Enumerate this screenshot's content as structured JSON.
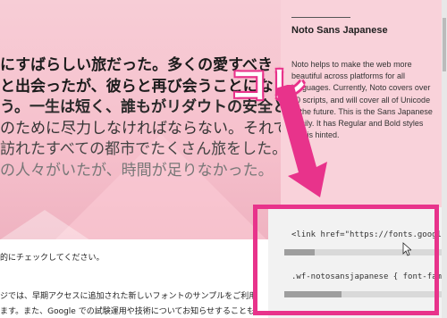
{
  "hero": {
    "lines": [
      "にすばらしい旅だった。多くの愛すべき",
      "と出会ったが、彼らと再び会うことにな",
      "う。一生は短く、誰もがリダウトの安全と",
      "のために尽力しなければならない。それで",
      "訪れたすべての都市でたくさん旅をした。",
      "の人々がいたが、時間が足りなかった。"
    ]
  },
  "side_panel": {
    "title": "Noto Sans Japanese",
    "description": "Noto helps to make the web more beautiful across platforms for all languages. Currently, Noto covers over 30 scripts, and will cover all of Unicode in the future. This is the Sans Japanese family. It has Regular and Bold styles and is hinted."
  },
  "code_panel": {
    "link_line": "<link href=\"https://fonts.googlea",
    "css_line": ".wf-notosansjapanese { font-fami"
  },
  "annotation": {
    "label": "コレ",
    "color": "#e8338b"
  },
  "lower": {
    "line1": "的にチェックしてください。",
    "line2": "ジでは、早期アクセスに追加された新しいフォントのサンプルをご利用",
    "line3": "ます。また、Google での試験運用や技術についてお知らせすることも"
  }
}
